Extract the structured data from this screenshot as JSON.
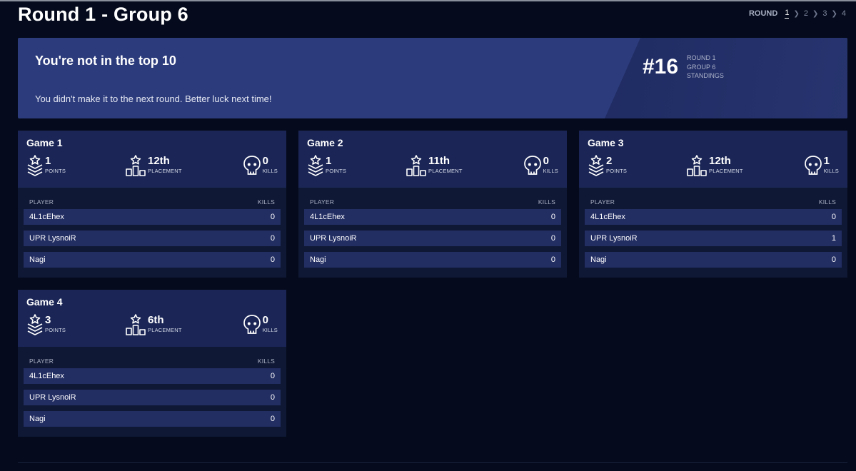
{
  "page": {
    "title": "Round 1 - Group 6"
  },
  "round_nav": {
    "label": "ROUND",
    "rounds": [
      "1",
      "2",
      "3",
      "4"
    ],
    "active": "1"
  },
  "banner": {
    "title": "You're not in the top 10",
    "message": "You didn't make it to the next round. Better luck next time!",
    "rank": "#16",
    "meta": [
      "ROUND 1",
      "GROUP 6",
      "STANDINGS"
    ]
  },
  "labels": {
    "points": "POINTS",
    "placement": "PLACEMENT",
    "kills": "KILLS",
    "player": "PLAYER"
  },
  "games": [
    {
      "title": "Game 1",
      "points": "1",
      "placement": "12th",
      "kills": "0",
      "players": [
        {
          "name": "4L1cEhex",
          "kills": "0"
        },
        {
          "name": "UPR LysnoiR",
          "kills": "0"
        },
        {
          "name": "Nagi",
          "kills": "0"
        }
      ]
    },
    {
      "title": "Game 2",
      "points": "1",
      "placement": "11th",
      "kills": "0",
      "players": [
        {
          "name": "4L1cEhex",
          "kills": "0"
        },
        {
          "name": "UPR LysnoiR",
          "kills": "0"
        },
        {
          "name": "Nagi",
          "kills": "0"
        }
      ]
    },
    {
      "title": "Game 3",
      "points": "2",
      "placement": "12th",
      "kills": "1",
      "players": [
        {
          "name": "4L1cEhex",
          "kills": "0"
        },
        {
          "name": "UPR LysnoiR",
          "kills": "1"
        },
        {
          "name": "Nagi",
          "kills": "0"
        }
      ]
    },
    {
      "title": "Game 4",
      "points": "3",
      "placement": "6th",
      "kills": "0",
      "players": [
        {
          "name": "4L1cEhex",
          "kills": "0"
        },
        {
          "name": "UPR LysnoiR",
          "kills": "0"
        },
        {
          "name": "Nagi",
          "kills": "0"
        }
      ]
    }
  ],
  "icons": {
    "points": "rank-chevron-icon",
    "placement": "podium-icon",
    "kills": "skull-icon"
  },
  "colors": {
    "background": "#050b1c",
    "banner": "#2c3b7c",
    "card": "#0f1835",
    "row": "#222d62"
  }
}
